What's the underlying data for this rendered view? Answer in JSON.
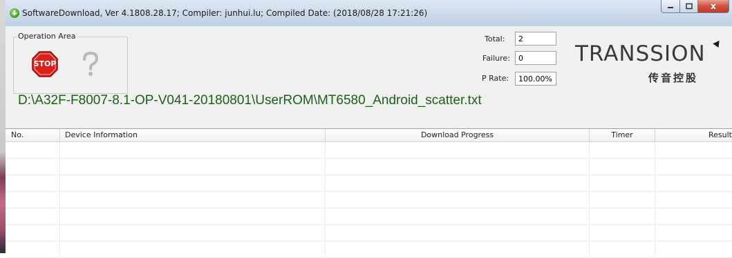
{
  "window": {
    "title": "SoftwareDownload, Ver 4.1808.28.17; Compiler: junhui.lu; Compiled Date: (2018/08/28 17:21:26)",
    "controls": {
      "minimize": "–",
      "maximize": "□",
      "close": "x"
    }
  },
  "operation_area": {
    "label": "Operation Area",
    "stop_label": "STOP",
    "stop_icon": "stop-sign-icon",
    "help_icon": "question-mark-icon"
  },
  "stats": {
    "total_label": "Total:",
    "total_value": "2",
    "failure_label": "Failure:",
    "failure_value": "0",
    "prate_label": "P Rate:",
    "prate_value": "100.00%"
  },
  "brand": {
    "name": "TRANSSION",
    "subtitle": "传音控股"
  },
  "scatter_path": "D:\\A32F-F8007-8.1-OP-V041-20180801\\UserROM\\MT6580_Android_scatter.txt",
  "table": {
    "columns": [
      "No.",
      "Device Information",
      "Download Progress",
      "Timer",
      "Result"
    ],
    "rows": [
      [
        "",
        "",
        "",
        "",
        ""
      ],
      [
        "",
        "",
        "",
        "",
        ""
      ],
      [
        "",
        "",
        "",
        "",
        ""
      ],
      [
        "",
        "",
        "",
        "",
        ""
      ],
      [
        "",
        "",
        "",
        "",
        ""
      ],
      [
        "",
        "",
        "",
        "",
        ""
      ],
      [
        "",
        "",
        "",
        "",
        ""
      ]
    ]
  },
  "colors": {
    "path_text": "#1e5f18",
    "stop_red": "#d8211a",
    "titlebar": "#cfdceb"
  }
}
